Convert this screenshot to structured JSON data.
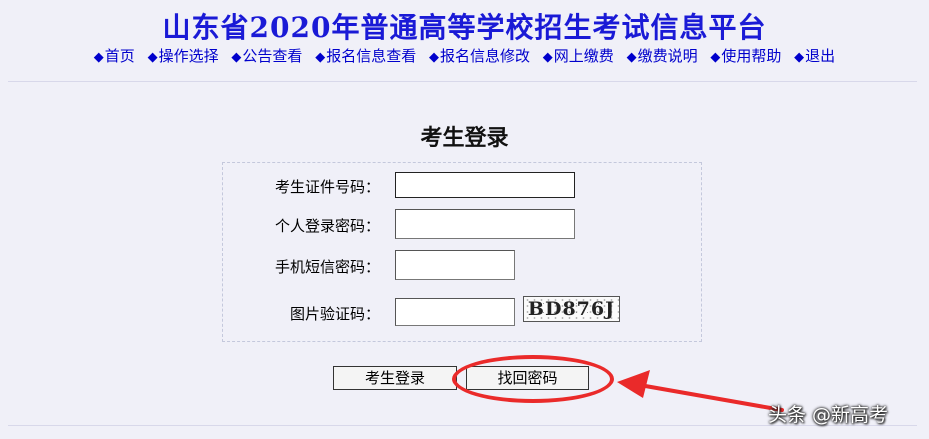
{
  "header": {
    "title": "山东省2020年普通高等学校招生考试信息平台"
  },
  "nav": {
    "bullet": "◆",
    "items": [
      {
        "label": "首页"
      },
      {
        "label": "操作选择"
      },
      {
        "label": "公告查看"
      },
      {
        "label": "报名信息查看"
      },
      {
        "label": "报名信息修改"
      },
      {
        "label": "网上缴费"
      },
      {
        "label": "缴费说明"
      },
      {
        "label": "使用帮助"
      },
      {
        "label": "退出"
      }
    ]
  },
  "login": {
    "title": "考生登录",
    "fields": {
      "id_number": {
        "label": "考生证件号码：",
        "value": ""
      },
      "password": {
        "label": "个人登录密码：",
        "value": ""
      },
      "sms_code": {
        "label": "手机短信密码：",
        "value": ""
      },
      "captcha_input": {
        "label": "图片验证码：",
        "value": ""
      }
    },
    "captcha_text": "BD876J",
    "buttons": {
      "login": "考生登录",
      "recover_password": "找回密码"
    }
  },
  "annotation": {
    "color": "#ea2a2a"
  },
  "watermark": "头条 @新高考"
}
